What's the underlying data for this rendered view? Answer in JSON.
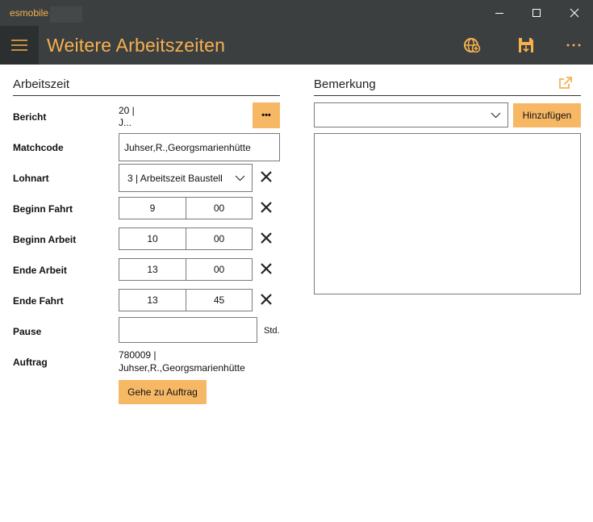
{
  "window": {
    "app_name": "esmobile",
    "minimize_label": "",
    "maximize_label": "",
    "close_label": ""
  },
  "header": {
    "title": "Weitere Arbeitszeiten"
  },
  "arbeitszeit": {
    "section_title": "Arbeitszeit",
    "bericht": {
      "label": "Bericht",
      "line1": "20  |",
      "line2": "J...",
      "more_label": "•••"
    },
    "matchcode": {
      "label": "Matchcode",
      "value": "Juhser,R.,Georgsmarienhütte"
    },
    "lohnart": {
      "label": "Lohnart",
      "value": "3  |  Arbeitszeit Baustell"
    },
    "beginn_fahrt": {
      "label": "Beginn Fahrt",
      "hour": "9",
      "minute": "00"
    },
    "beginn_arbeit": {
      "label": "Beginn Arbeit",
      "hour": "10",
      "minute": "00"
    },
    "ende_arbeit": {
      "label": "Ende Arbeit",
      "hour": "13",
      "minute": "00"
    },
    "ende_fahrt": {
      "label": "Ende Fahrt",
      "hour": "13",
      "minute": "45"
    },
    "pause": {
      "label": "Pause",
      "value": "",
      "unit": "Std."
    },
    "auftrag": {
      "label": "Auftrag",
      "line1": "780009  |",
      "line2": "Juhser,R.,Georgsmarienhütte",
      "button_label": "Gehe zu Auftrag"
    }
  },
  "bemerkung": {
    "section_title": "Bemerkung",
    "select_value": "",
    "add_button_label": "Hinzufügen",
    "text_value": ""
  },
  "colors": {
    "accent": "#f7b04e",
    "bar_bg": "#3b3f40",
    "button_bg": "#f7b866"
  },
  "icons": {
    "hamburger": "hamburger-menu-icon",
    "sync": "globe-sync-icon",
    "save": "save-download-icon",
    "more": "more-dots-icon",
    "external": "open-external-icon",
    "clear": "close-x-icon",
    "dropdown": "chevron-down-icon"
  }
}
